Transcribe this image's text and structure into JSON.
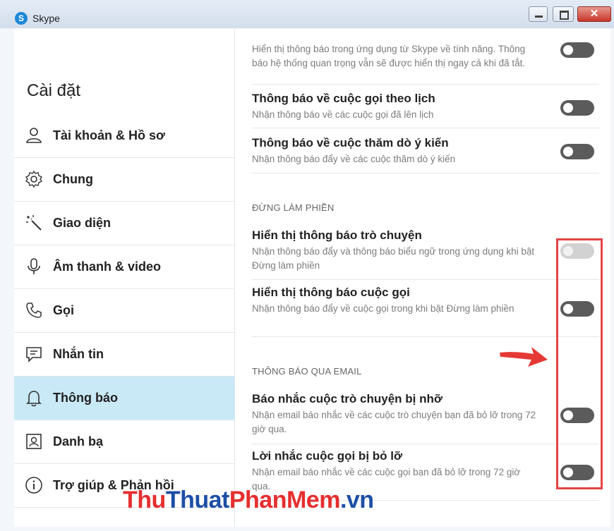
{
  "window": {
    "app_icon": "S",
    "title": "Skype",
    "close_glyph": "✕"
  },
  "sidebar": {
    "title": "Cài đặt",
    "items": [
      {
        "label": "Tài khoản & Hồ sơ",
        "icon": "person-icon"
      },
      {
        "label": "Chung",
        "icon": "gear-icon"
      },
      {
        "label": "Giao diện",
        "icon": "magic-wand-icon"
      },
      {
        "label": "Âm thanh & video",
        "icon": "microphone-icon"
      },
      {
        "label": "Gọi",
        "icon": "phone-icon"
      },
      {
        "label": "Nhắn tin",
        "icon": "chat-icon"
      },
      {
        "label": "Thông báo",
        "icon": "bell-icon",
        "active": true
      },
      {
        "label": "Danh bạ",
        "icon": "contacts-icon"
      },
      {
        "label": "Trợ giúp & Phản hồi",
        "icon": "info-icon"
      }
    ]
  },
  "content": {
    "top_partial_desc": "Hiển thị thông báo trong ứng dụng từ Skype về tính năng. Thông báo hệ thống quan trọng vẫn sẽ được hiển thị ngay cả khi đã tắt.",
    "scheduled_calls": {
      "title": "Thông báo về cuộc gọi theo lịch",
      "desc": "Nhận thông báo về các cuộc gọi đã lên lịch"
    },
    "polls": {
      "title": "Thông báo về cuộc thăm dò ý kiến",
      "desc": "Nhận thông báo đẩy về các cuộc thăm dò ý kiến"
    },
    "dnd_header": "ĐỪNG LÀM PHIỀN",
    "chat_notifications": {
      "title": "Hiển thị thông báo trò chuyện",
      "desc": "Nhận thông báo đẩy và thông báo biểu ngữ trong ứng dụng khi bật Đừng làm phiền"
    },
    "call_notifications": {
      "title": "Hiển thị thông báo cuộc gọi",
      "desc": "Nhận thông báo đẩy về cuộc gọi trong khi bật Đừng làm phiền"
    },
    "email_header": "THÔNG BÁO QUA EMAIL",
    "missed_chat": {
      "title": "Báo nhắc cuộc trò chuyện bị nhỡ",
      "desc": "Nhận email báo nhắc về các cuộc trò chuyện bạn đã bỏ lỡ trong 72 giờ qua."
    },
    "missed_call": {
      "title": "Lời nhắc cuộc gọi bị bỏ lỡ",
      "desc": "Nhận email báo nhắc về các cuộc gọi bạn đã bỏ lỡ trong 72 giờ qua."
    }
  },
  "watermark": {
    "part1": "Thu",
    "part2": "Thuat",
    "part3": "PhanMem",
    "part4": ".vn"
  },
  "colors": {
    "accent_active": "#c9e9f6",
    "highlight": "#e34444",
    "toggle_off": "#5b5b5b"
  }
}
